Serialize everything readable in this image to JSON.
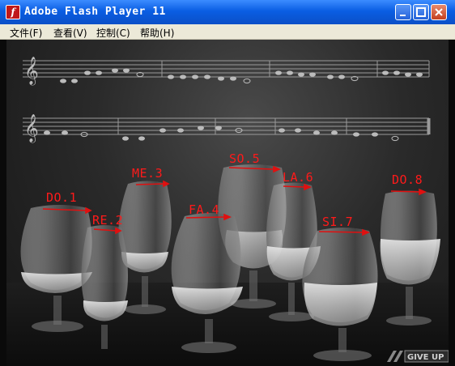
{
  "window": {
    "title": "Adobe Flash Player 11",
    "app_icon_glyph": "f"
  },
  "menu": [
    {
      "label": "文件(F)"
    },
    {
      "label": "查看(V)"
    },
    {
      "label": "控制(C)"
    },
    {
      "label": "帮助(H)"
    }
  ],
  "glasses": [
    {
      "label": "DO.1"
    },
    {
      "label": "RE.2"
    },
    {
      "label": "ME.3"
    },
    {
      "label": "FA.4"
    },
    {
      "label": "SO.5"
    },
    {
      "label": "LA.6"
    },
    {
      "label": "SI.7"
    },
    {
      "label": "DO.8"
    }
  ],
  "give_up_label": "GIVE UP",
  "colors": {
    "title_bar": "#0a5ee3",
    "label_red": "#ff1a1a",
    "stage_bg": "#2a2a2a"
  }
}
